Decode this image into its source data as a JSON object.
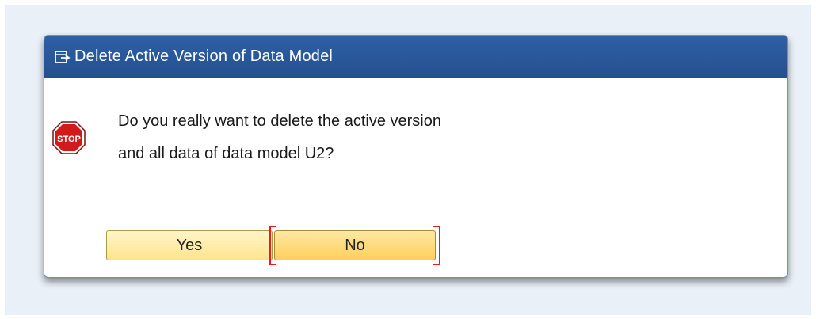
{
  "dialog": {
    "title": "Delete Active Version of Data Model",
    "title_icon": "window-menu-icon",
    "status_icon": "stop-icon",
    "status_icon_text": "STOP",
    "message_line1": "Do you really want to delete the active version",
    "message_line2": "and all data of data model U2?",
    "buttons": {
      "yes_label": "Yes",
      "no_label": "No",
      "focused": "No"
    }
  },
  "colors": {
    "titlebar": "#2a5a9e",
    "button_fill": "#ffe48c",
    "focus_marker": "#e81e1e",
    "stop_sign": "#d21a1a"
  }
}
